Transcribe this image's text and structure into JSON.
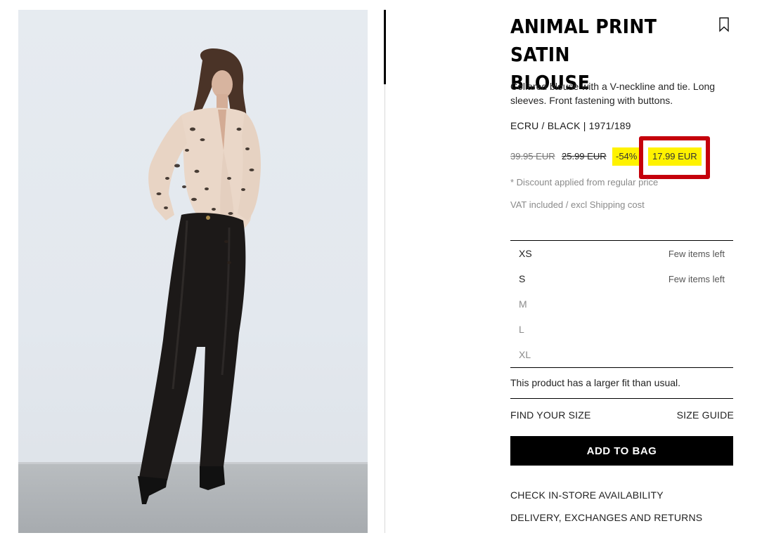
{
  "product": {
    "title": "ANIMAL PRINT SATIN\nBLOUSE",
    "description": "Collared blouse with a V-neckline and tie. Long sleeves. Front fastening with buttons.",
    "color_ref": "ECRU / BLACK | 1971/189",
    "image_alt": "model wearing blouse"
  },
  "pricing": {
    "original_price": "39.95 EUR",
    "previous_price": "25.99 EUR",
    "discount": "-54%",
    "current_price": "17.99 EUR",
    "discount_note": "* Discount applied from regular price",
    "vat_note": "VAT included / excl Shipping cost",
    "highlight_color": "#fff200",
    "annotation_color": "#c5000b"
  },
  "sizes": [
    {
      "label": "XS",
      "stock": "Few items left",
      "available": true
    },
    {
      "label": "S",
      "stock": "Few items left",
      "available": true
    },
    {
      "label": "M",
      "stock": "",
      "available": false
    },
    {
      "label": "L",
      "stock": "",
      "available": false
    },
    {
      "label": "XL",
      "stock": "",
      "available": false
    }
  ],
  "fit_note": "This product has a larger fit than usual.",
  "actions": {
    "find_size": "FIND YOUR SIZE",
    "size_guide": "SIZE GUIDE",
    "add_to_bag": "ADD TO BAG",
    "store_availability": "CHECK IN-STORE AVAILABILITY",
    "delivery": "DELIVERY, EXCHANGES AND RETURNS"
  },
  "icons": {
    "bookmark": "bookmark-icon"
  }
}
